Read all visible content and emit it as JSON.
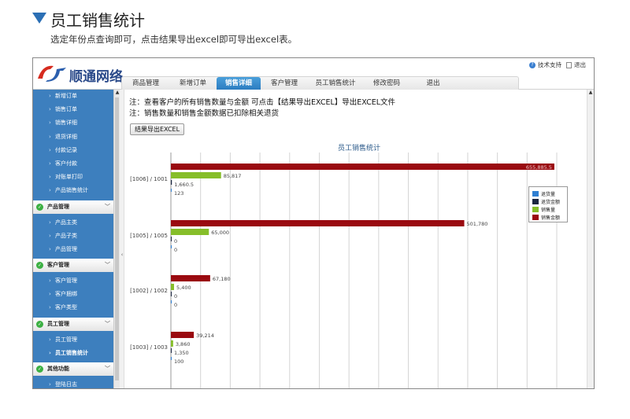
{
  "intro": {
    "title": "员工销售统计",
    "desc": "选定年份点查询即可，点击结果导出excel即可导出excel表。"
  },
  "app": {
    "logo_text": "顺通网络",
    "links": {
      "support": "技术支持",
      "exit": "退出"
    },
    "tabs": [
      {
        "label": "商品管理",
        "active": false
      },
      {
        "label": "新增订单",
        "active": false
      },
      {
        "label": "销售详细",
        "active": true
      },
      {
        "label": "客户管理",
        "active": false
      },
      {
        "label": "员工销售统计",
        "active": false
      },
      {
        "label": "修改密码",
        "active": false
      },
      {
        "label": "退出",
        "active": false
      }
    ]
  },
  "sidebar": {
    "top_items": [
      "新增订单",
      "销售订单",
      "销售详细",
      "退货详细",
      "付款记录",
      "客户付款",
      "对账单打印",
      "产品销售统计"
    ],
    "groups": [
      {
        "title": "产品管理",
        "items": [
          "产品主类",
          "产品子类",
          "产品管理"
        ]
      },
      {
        "title": "客户管理",
        "items": [
          "客户管理",
          "客户捆绑",
          "客户类型"
        ]
      },
      {
        "title": "员工管理",
        "items": [
          "员工管理",
          "员工销售统计"
        ]
      },
      {
        "title": "其他功能",
        "items": [
          "登陆日志"
        ]
      }
    ],
    "current": "员工销售统计"
  },
  "content": {
    "note1": "注：查看客户的所有销售数量与金额 可点击【结果导出EXCEL】导出EXCEL文件",
    "note2": "注：销售数量和销售金额数据已扣除相关退货",
    "export_label": "结果导出EXCEL"
  },
  "colors": {
    "return_qty": "#2f7fd2",
    "return_amt": "#1a2540",
    "sales_qty": "#86be2a",
    "sales_amt": "#9a0a10"
  },
  "chart_data": {
    "type": "bar",
    "orientation": "horizontal",
    "title": "员工销售统计",
    "categories": [
      "[1006] / 1001",
      "[1005] / 1005",
      "[1002] / 1002",
      "[1003] / 1003"
    ],
    "series": [
      {
        "name": "销售金额",
        "values": [
          655885.5,
          501780,
          67180,
          39214
        ],
        "labels": [
          "655,885.5",
          "501,780",
          "67,180",
          "39,214"
        ]
      },
      {
        "name": "销售量",
        "values": [
          85817,
          65000,
          5400,
          3860
        ],
        "labels": [
          "85,817",
          "65,000",
          "5,400",
          "3,860"
        ]
      },
      {
        "name": "退货金额",
        "values": [
          1660.5,
          0,
          0,
          1350
        ],
        "labels": [
          "1,660.5",
          "0",
          "0",
          "1,350"
        ]
      },
      {
        "name": "退货量",
        "values": [
          123,
          0,
          0,
          100
        ],
        "labels": [
          "123",
          "0",
          "0",
          "100"
        ]
      }
    ],
    "legend": [
      "退货量",
      "退货金额",
      "销售量",
      "销售金额"
    ],
    "xlim": [
      0,
      660000
    ],
    "grid": true,
    "legend_position": "right"
  }
}
